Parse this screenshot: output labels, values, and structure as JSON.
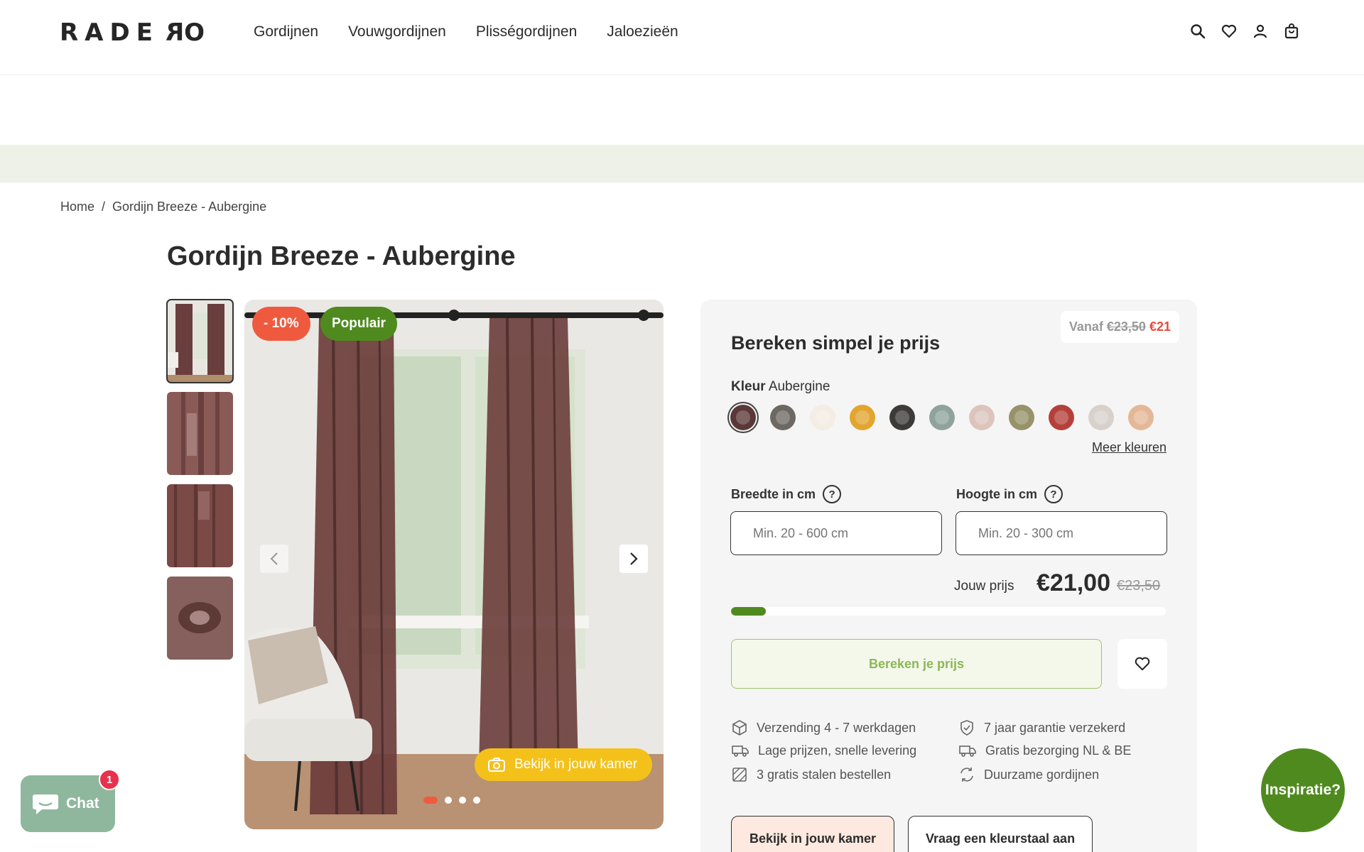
{
  "header": {
    "logo": "RADERO",
    "nav": [
      "Gordijnen",
      "Vouwgordijnen",
      "Plisségordijnen",
      "Jaloezieën"
    ],
    "icons": [
      "search-icon",
      "heart-icon",
      "user-icon",
      "cart-icon"
    ]
  },
  "breadcrumb": {
    "home": "Home",
    "separator": "/",
    "current": "Gordijn Breeze - Aubergine"
  },
  "product": {
    "title": "Gordijn Breeze - Aubergine",
    "badge_discount": "- 10%",
    "badge_popular": "Populair",
    "view_in_room": "Bekijk in jouw kamer",
    "slide_count": 4,
    "active_slide": 1
  },
  "price_card": {
    "title": "Bereken simpel je prijs",
    "from_label": "Vanaf",
    "from_old": "€23,50",
    "from_new": "€21",
    "color_label": "Kleur",
    "color_value": "Aubergine",
    "swatches": [
      "#5b3838",
      "#6e6862",
      "#f3ede4",
      "#e2a52f",
      "#3d3a38",
      "#8fa39c",
      "#dcc4bd",
      "#97926a",
      "#b5403a",
      "#d8d1cb",
      "#e4b896"
    ],
    "more_colors": "Meer kleuren",
    "width_label": "Breedte in cm",
    "width_placeholder": "Min. 20 - 600 cm",
    "height_label": "Hoogte in cm",
    "height_placeholder": "Min. 20 - 300 cm",
    "help": "?",
    "your_price_label": "Jouw prijs",
    "your_price": "€21,00",
    "your_price_old": "€23,50",
    "progress": 0.08,
    "calc_button": "Bereken je prijs",
    "usps": [
      "Verzending 4 - 7 werkdagen",
      "7 jaar garantie verzekerd",
      "Lage prijzen, snelle levering",
      "Gratis bezorging NL & BE",
      "3 gratis stalen bestellen",
      "Duurzame gordijnen"
    ],
    "btn_room": "Bekijk in jouw kamer",
    "btn_sample": "Vraag een kleurstaal aan"
  },
  "chat": {
    "label": "Chat",
    "badge": "1"
  },
  "inspiration": "Inspiratie?"
}
